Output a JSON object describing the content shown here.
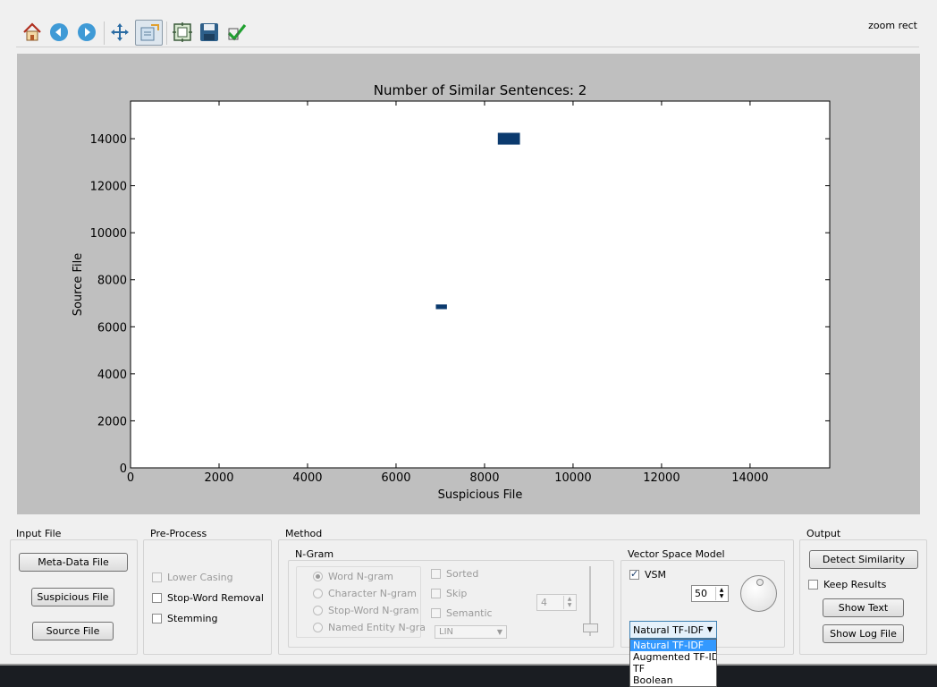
{
  "toolbar": {
    "buttons": [
      {
        "icon": "home-icon"
      },
      {
        "icon": "back-arrow-icon"
      },
      {
        "icon": "forward-arrow-icon"
      },
      {
        "icon": "pan-move-icon"
      },
      {
        "icon": "zoom-rect-icon",
        "active": true
      },
      {
        "icon": "configure-subplots-icon"
      },
      {
        "icon": "save-floppy-icon"
      },
      {
        "icon": "checkmark-icon"
      }
    ],
    "mode_label": "zoom rect"
  },
  "chart_data": {
    "type": "heatmap",
    "title": "Number of Similar Sentences: 2",
    "xlabel": "Suspicious File",
    "ylabel": "Source File",
    "xlim": [
      0,
      15800
    ],
    "ylim": [
      0,
      15600
    ],
    "x_ticks": [
      "0",
      "2000",
      "4000",
      "6000",
      "8000",
      "10000",
      "12000",
      "14000"
    ],
    "y_ticks": [
      "0",
      "2000",
      "4000",
      "6000",
      "8000",
      "10000",
      "12000",
      "14000"
    ],
    "color": "#0b3a6e",
    "background": "#ffffff",
    "cells": [
      {
        "x0": 8300,
        "x1": 8800,
        "y0": 13750,
        "y1": 14250
      },
      {
        "x0": 6900,
        "x1": 7150,
        "y0": 6750,
        "y1": 6950
      }
    ]
  },
  "input_file": {
    "title": "Input File",
    "meta_btn": "Meta-Data File",
    "susp_btn": "Suspicious File",
    "src_btn": "Source File"
  },
  "preprocess": {
    "title": "Pre-Process",
    "lower": "Lower Casing",
    "stop": "Stop-Word Removal",
    "stem": "Stemming"
  },
  "method": {
    "title": "Method",
    "ngram_title": "N-Gram",
    "word": "Word N-gram",
    "char": "Character N-gram",
    "stopword": "Stop-Word N-gram",
    "named": "Named Entity N-gra",
    "sorted": "Sorted",
    "skip": "Skip",
    "semantic": "Semantic",
    "n_value": "4",
    "lin_value": "LIN"
  },
  "vsm": {
    "title": "Vector Space Model",
    "vsm_label": "VSM",
    "vsm_checked": true,
    "spin_value": "50",
    "combo_value": "Natural TF-IDF",
    "options": [
      "Natural TF-IDF",
      "Augmented TF-IDF",
      "TF",
      "Boolean"
    ]
  },
  "output": {
    "title": "Output",
    "detect_btn": "Detect Similarity",
    "keep": "Keep Results",
    "show_text": "Show Text",
    "show_log": "Show Log File"
  }
}
